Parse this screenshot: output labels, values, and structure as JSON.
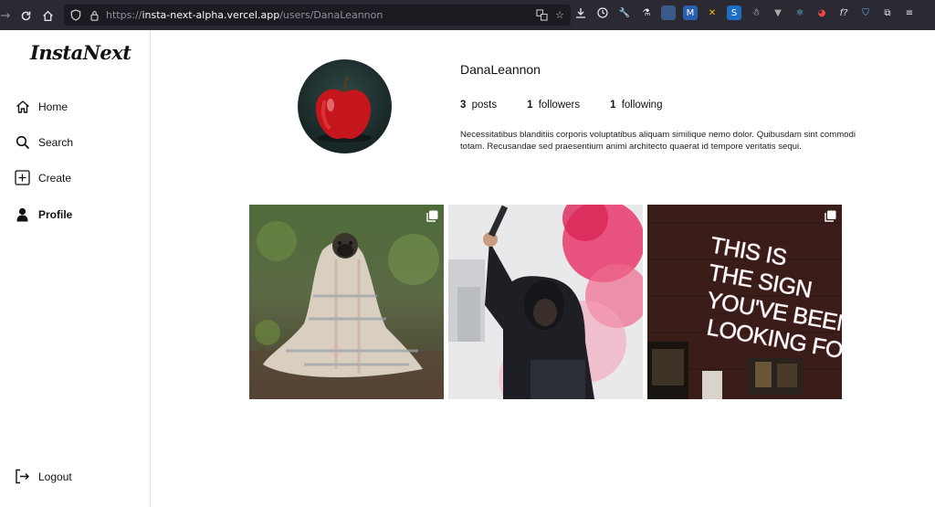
{
  "browser": {
    "url_prefix": "https://",
    "url_host": "insta-next-alpha.vercel.app",
    "url_path": "/users/DanaLeannon"
  },
  "sidebar": {
    "logo": "InstaNext",
    "items": [
      {
        "label": "Home",
        "icon": "home-icon"
      },
      {
        "label": "Search",
        "icon": "search-icon"
      },
      {
        "label": "Create",
        "icon": "plus-square-icon"
      },
      {
        "label": "Profile",
        "icon": "user-icon"
      }
    ],
    "logout": "Logout"
  },
  "profile": {
    "username": "DanaLeannon",
    "posts_count": "3",
    "posts_label": "posts",
    "followers_count": "1",
    "followers_label": "followers",
    "following_count": "1",
    "following_label": "following",
    "bio": "Necessitatibus blanditiis corporis voluptatibus aliquam similique nemo dolor. Quibusdam sint commodi totam. Recusandae sed praesentium animi architecto quaerat id tempore veritatis sequi."
  },
  "posts": [
    {
      "image": "pug-in-blanket",
      "multi": true
    },
    {
      "image": "person-with-pink-smoke-flare",
      "multi": false
    },
    {
      "image": "neon-sign",
      "multi": true,
      "sign_lines": [
        "THIS IS",
        "THE SIGN",
        "YOU'VE BEEN",
        "LOOKING FOR"
      ]
    }
  ]
}
